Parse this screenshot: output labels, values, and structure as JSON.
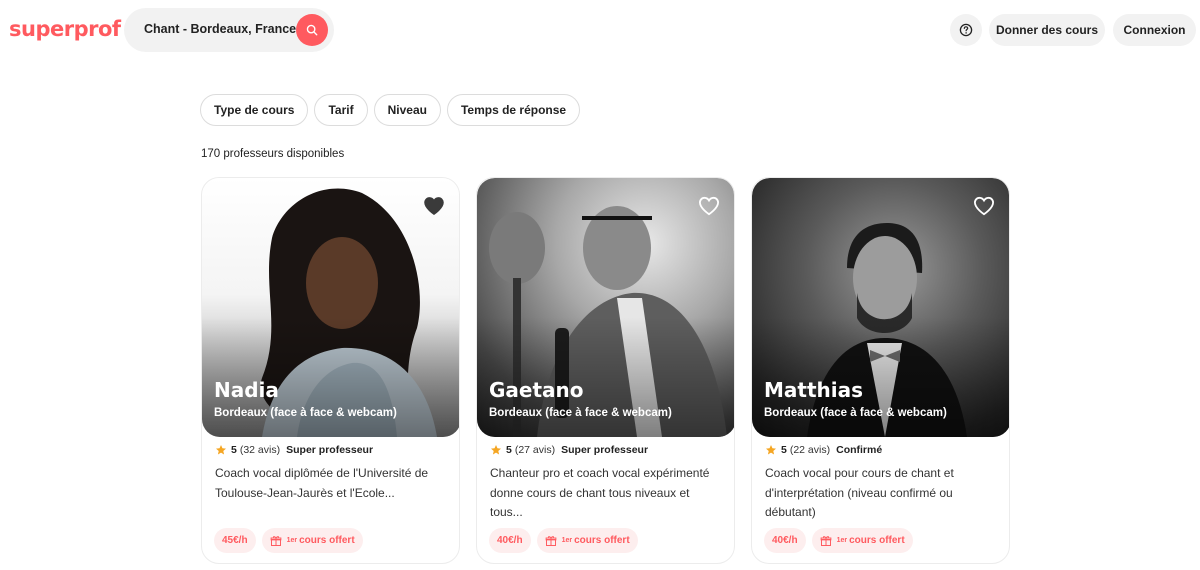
{
  "header": {
    "logo": "superprof",
    "search_value": "Chant - Bordeaux, France",
    "give_lessons": "Donner des cours",
    "login": "Connexion"
  },
  "filters": [
    "Type de cours",
    "Tarif",
    "Niveau",
    "Temps de réponse"
  ],
  "results_count": "170 professeurs disponibles",
  "colors": {
    "brand": "#ff5a5f",
    "star": "#f5a623",
    "tag_bg": "#fdeeee"
  },
  "teachers": [
    {
      "name": "Nadia",
      "location": "Bordeaux (face à face & webcam)",
      "rating": "5",
      "reviews": "(32 avis)",
      "badge": "Super professeur",
      "description": "Coach vocal diplômée de l'Université de Toulouse-Jean-Jaurès et l'Ecole...",
      "price": "45€/h",
      "offer_sup": "1er",
      "offer": "cours offert"
    },
    {
      "name": "Gaetano",
      "location": "Bordeaux (face à face & webcam)",
      "rating": "5",
      "reviews": "(27 avis)",
      "badge": "Super professeur",
      "description": "Chanteur pro et coach vocal expérimenté donne cours de chant tous niveaux et tous...",
      "price": "40€/h",
      "offer_sup": "1er",
      "offer": "cours offert"
    },
    {
      "name": "Matthias",
      "location": "Bordeaux (face à face & webcam)",
      "rating": "5",
      "reviews": "(22 avis)",
      "badge": "Confirmé",
      "description": "Coach vocal pour cours de chant et d'interprétation (niveau confirmé ou débutant)",
      "price": "40€/h",
      "offer_sup": "1er",
      "offer": "cours offert"
    }
  ]
}
